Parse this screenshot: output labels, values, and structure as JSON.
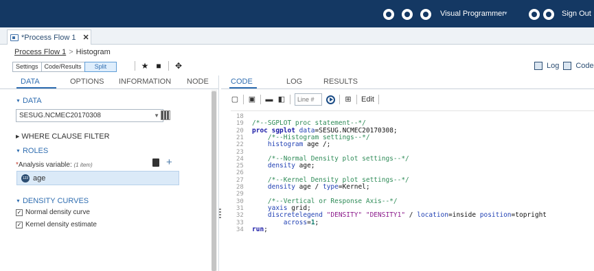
{
  "topbar": {
    "user_menu": "Visual Programmer",
    "caret": "▾",
    "sign_out": "Sign Out"
  },
  "tabs": [
    {
      "label": "*Process Flow 1",
      "close": "✕"
    }
  ],
  "breadcrumb": {
    "parent": "Process Flow 1",
    "separator": ">",
    "current": "Histogram"
  },
  "view_toggles": [
    "Settings",
    "Code/Results",
    "Split"
  ],
  "right_tools": [
    {
      "label": "Log"
    },
    {
      "label": "Code"
    }
  ],
  "left_panel": {
    "tabs": [
      "DATA",
      "OPTIONS",
      "INFORMATION",
      "NODE"
    ],
    "data_section": "DATA",
    "dataset": "SESUG.NCMEC20170308",
    "where_section": "WHERE CLAUSE FILTER",
    "roles_section": "ROLES",
    "analysis_required_mark": "*",
    "analysis_label": "Analysis variable:",
    "analysis_hint": "(1 item)",
    "variable": "age",
    "variable_icon_text": "123",
    "density_section": "DENSITY CURVES",
    "checkboxes": [
      {
        "label": "Normal density curve",
        "checked": true
      },
      {
        "label": "Kernel density estimate",
        "checked": true
      }
    ]
  },
  "right_panel": {
    "tabs": [
      "CODE",
      "LOG",
      "RESULTS"
    ],
    "line_placeholder": "Line #",
    "edit_label": "Edit",
    "code_lines": [
      {
        "n": "18",
        "parts": []
      },
      {
        "n": "19",
        "parts": [
          {
            "c": "cmt",
            "t": "/*--SGPLOT proc statement--*/"
          }
        ]
      },
      {
        "n": "20",
        "parts": [
          {
            "c": "kw",
            "t": "proc sgplot "
          },
          {
            "c": "kw2",
            "t": "data"
          },
          {
            "c": "plain",
            "t": "=SESUG.NCMEC20170308;"
          }
        ]
      },
      {
        "n": "21",
        "parts": [
          {
            "c": "cmt",
            "t": "    /*--Histogram settings--*/"
          }
        ]
      },
      {
        "n": "22",
        "parts": [
          {
            "c": "kw2",
            "t": "    histogram"
          },
          {
            "c": "plain",
            "t": " age /;"
          }
        ]
      },
      {
        "n": "23",
        "parts": []
      },
      {
        "n": "24",
        "parts": [
          {
            "c": "cmt",
            "t": "    /*--Normal Density plot settings--*/"
          }
        ]
      },
      {
        "n": "25",
        "parts": [
          {
            "c": "kw2",
            "t": "    density"
          },
          {
            "c": "plain",
            "t": " age;"
          }
        ]
      },
      {
        "n": "26",
        "parts": []
      },
      {
        "n": "27",
        "parts": [
          {
            "c": "cmt",
            "t": "    /*--Kernel Density plot settings--*/"
          }
        ]
      },
      {
        "n": "28",
        "parts": [
          {
            "c": "kw2",
            "t": "    density"
          },
          {
            "c": "plain",
            "t": " age / "
          },
          {
            "c": "kw2",
            "t": "type"
          },
          {
            "c": "plain",
            "t": "=Kernel;"
          }
        ]
      },
      {
        "n": "29",
        "parts": []
      },
      {
        "n": "30",
        "parts": [
          {
            "c": "cmt",
            "t": "    /*--Vertical or Response Axis--*/"
          }
        ]
      },
      {
        "n": "31",
        "parts": [
          {
            "c": "kw2",
            "t": "    yaxis"
          },
          {
            "c": "plain",
            "t": " grid;"
          }
        ]
      },
      {
        "n": "32",
        "parts": [
          {
            "c": "kw2",
            "t": "    discretelegend"
          },
          {
            "c": "str",
            "t": " \"DENSITY\" \"DENSITY1\""
          },
          {
            "c": "plain",
            "t": " / "
          },
          {
            "c": "kw2",
            "t": "location"
          },
          {
            "c": "plain",
            "t": "=inside "
          },
          {
            "c": "kw2",
            "t": "position"
          },
          {
            "c": "plain",
            "t": "=topright"
          }
        ]
      },
      {
        "n": "33",
        "parts": [
          {
            "c": "kw2",
            "t": "        across"
          },
          {
            "c": "plain",
            "t": "="
          },
          {
            "c": "num",
            "t": "1"
          },
          {
            "c": "plain",
            "t": ";"
          }
        ]
      },
      {
        "n": "34",
        "parts": [
          {
            "c": "kw",
            "t": "run"
          },
          {
            "c": "plain",
            "t": ";"
          }
        ]
      }
    ]
  },
  "colors": {
    "topbar": "#143863",
    "accent": "#2f6db0"
  }
}
